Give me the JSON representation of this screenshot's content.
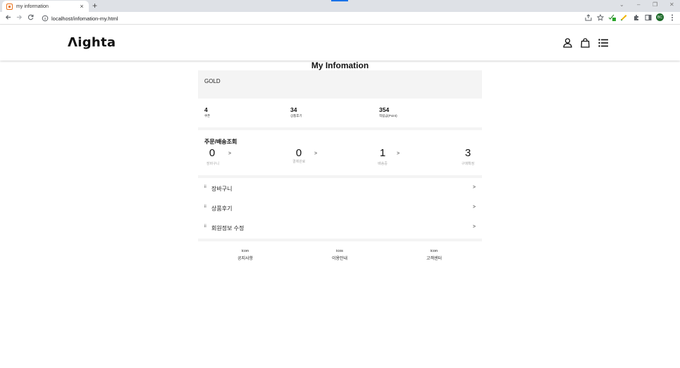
{
  "browser": {
    "tab_title": "my information",
    "new_tab": "+",
    "tab_close": "×",
    "url": "localhost/infomation-my.html",
    "profile_initials": "BC",
    "window_minimize": "–",
    "window_restore": "❐",
    "window_close": "✕",
    "tab_search": "⌄"
  },
  "header": {
    "logo": "Λighta"
  },
  "page": {
    "title": "My Infomation",
    "grade": "GOLD"
  },
  "stats": [
    {
      "value": "4",
      "label": "쿠폰"
    },
    {
      "value": "34",
      "label": "상품후기"
    },
    {
      "value": "354",
      "label": "적립금(Point)"
    }
  ],
  "order_status": {
    "title": "주문/배송조회",
    "arrow": ">",
    "steps": [
      {
        "count": "0",
        "label": "장바구니"
      },
      {
        "count": "0",
        "label": "결제완료"
      },
      {
        "count": "1",
        "label": "배송중"
      },
      {
        "count": "3",
        "label": "구매확정"
      }
    ]
  },
  "menu": {
    "bullet": "ii",
    "arrow": ">",
    "items": [
      {
        "label": "장바구니"
      },
      {
        "label": "상품후기"
      },
      {
        "label": "회원정보 수정"
      }
    ]
  },
  "footer_links": [
    {
      "icon_text": "icon",
      "label": "공지사항"
    },
    {
      "icon_text": "icos",
      "label": "이용안내"
    },
    {
      "icon_text": "icon",
      "label": "고객센터"
    }
  ]
}
